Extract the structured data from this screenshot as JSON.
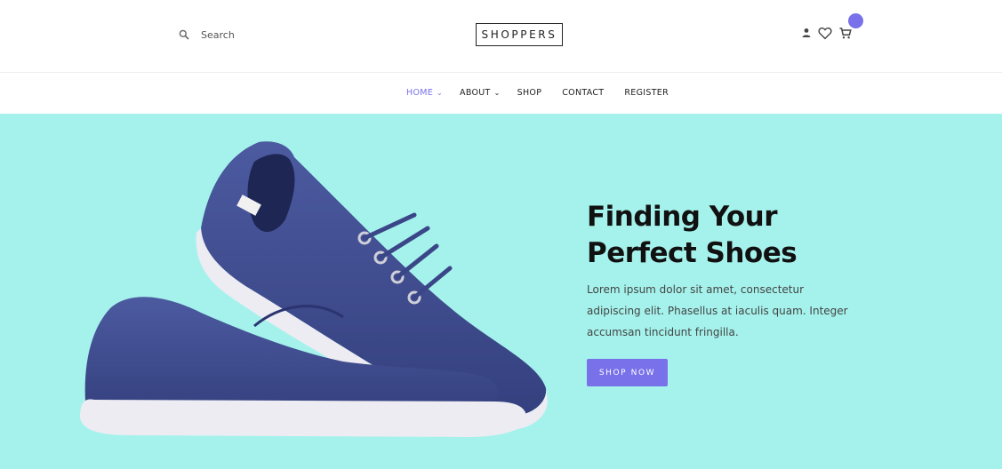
{
  "header": {
    "search": {
      "placeholder": "Search",
      "icon": "search-icon"
    },
    "logo": "SHOPPERS",
    "icons": [
      "user-icon",
      "heart-icon",
      "cart-icon"
    ],
    "cart_badge_color": "#7971ea"
  },
  "nav": {
    "items": [
      {
        "label": "HOME",
        "active": true,
        "dropdown": true
      },
      {
        "label": "ABOUT",
        "active": false,
        "dropdown": true
      },
      {
        "label": "SHOP",
        "active": false,
        "dropdown": false
      },
      {
        "label": "CONTACT",
        "active": false,
        "dropdown": false
      },
      {
        "label": "REGISTER",
        "active": false,
        "dropdown": false
      }
    ],
    "active_color": "#7971ea"
  },
  "hero": {
    "title_line1": "Finding Your",
    "title_line2": "Perfect Shoes",
    "text": "Lorem ipsum dolor sit amet, consectetur adipiscing elit. Phasellus at iaculis quam. Integer accumsan tincidunt fringilla.",
    "button_label": "SHOP NOW",
    "background_color": "#a5f2ec",
    "image": "sneakers-image"
  }
}
